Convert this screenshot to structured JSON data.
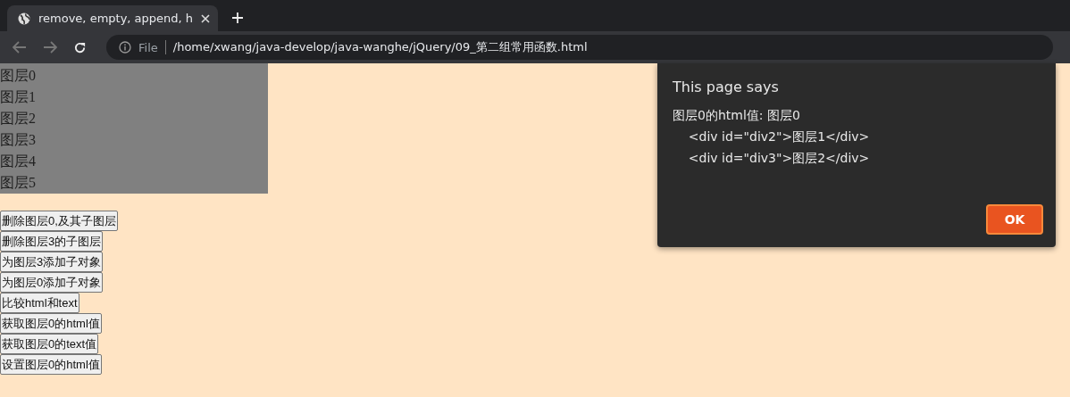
{
  "browser": {
    "tab": {
      "title": "remove, empty, append, h",
      "selected": true
    },
    "address": {
      "scheme_label": "File",
      "url": "/home/xwang/java-develop/java-wanghe/jQuery/09_第二组常用函数.html"
    }
  },
  "layers": [
    "图层0",
    "图层1",
    "图层2",
    "图层3",
    "图层4",
    "图层5"
  ],
  "buttons": [
    "删除图层0,及其子图层",
    "删除图层3的子图层",
    "为图层3添加子对象",
    "为图层0添加子对象",
    "比较html和text",
    "获取图层0的html值",
    "获取图层0的text值",
    "设置图层0的html值"
  ],
  "dialog": {
    "title": "This page says",
    "message": "图层0的html值: 图层0\n\t<div id=\"div2\">图层1</div>\n\t<div id=\"div3\">图层2</div>",
    "button": "OK"
  }
}
